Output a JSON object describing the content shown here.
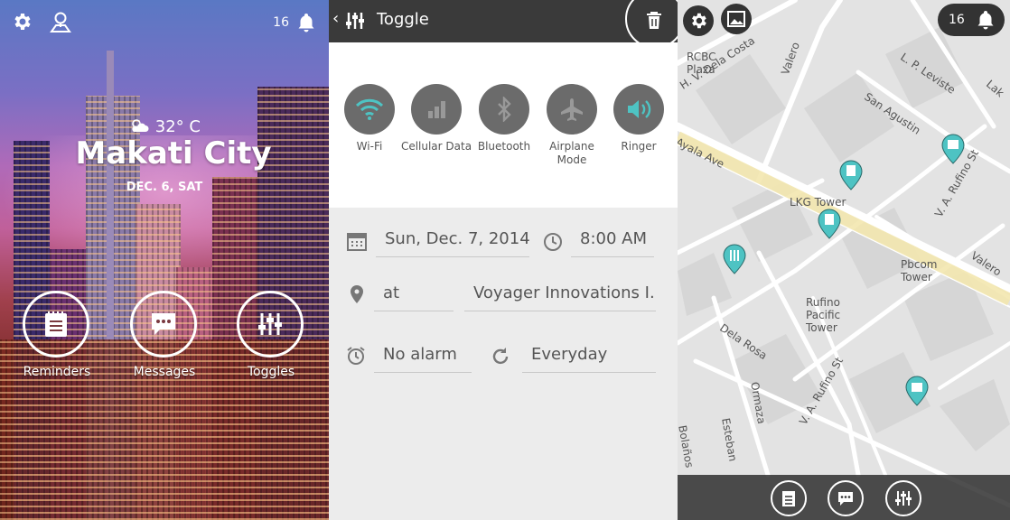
{
  "home": {
    "notification_count": "16",
    "temperature": "32° C",
    "city": "Makati City",
    "date": "DEC. 6, SAT",
    "buttons": [
      {
        "label": "Reminders"
      },
      {
        "label": "Messages"
      },
      {
        "label": "Toggles"
      }
    ]
  },
  "toggle_screen": {
    "title": "Toggle",
    "toggles": [
      {
        "label": "Wi-Fi",
        "active": true
      },
      {
        "label": "Cellular Data",
        "active": false
      },
      {
        "label": "Bluetooth",
        "active": false
      },
      {
        "label": "Airplane Mode",
        "active": false
      },
      {
        "label": "Ringer",
        "active": true
      }
    ],
    "date_value": "Sun, Dec. 7, 2014",
    "time_value": "8:00 AM",
    "location_prefix": "at",
    "location_value": "Voyager Innovations I..",
    "alarm_value": "No alarm",
    "repeat_value": "Everyday"
  },
  "map": {
    "notification_count": "16",
    "streets": [
      "H. V. Dela Costa",
      "Valero",
      "L. P. Leviste",
      "San Agustin",
      "V. A. Rufino St",
      "Ayala Ave",
      "Dela Rosa",
      "Ormaza",
      "Esteban",
      "Bolaños",
      "V. A. Rufino St",
      "Valero",
      "Lak"
    ],
    "places": [
      "RCBC Plaza",
      "LKG Tower",
      "Pbcom Tower",
      "Rufino Pacific Tower"
    ]
  },
  "colors": {
    "accent_teal": "#4ec3c3",
    "dark_bar": "#3a3a3a",
    "toggle_gray": "#6b6b6b"
  }
}
